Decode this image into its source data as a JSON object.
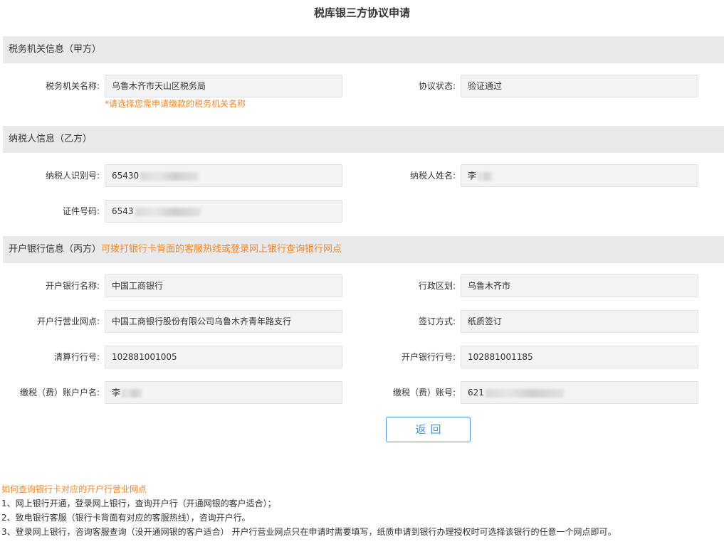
{
  "page": {
    "title": "税库银三方协议申请"
  },
  "section_a": {
    "header": "税务机关信息（甲方）",
    "tax_office_label": "税务机关名称:",
    "tax_office_value": "乌鲁木齐市天山区税务局",
    "tax_office_note": "*请选择您需申请缴款的税务机关名称",
    "status_label": "协议状态:",
    "status_value": "验证通过"
  },
  "section_b": {
    "header": "纳税人信息（乙方）",
    "taxpayer_id_label": "纳税人识别号:",
    "taxpayer_id_value": "65430",
    "taxpayer_name_label": "纳税人姓名:",
    "taxpayer_name_value": "李",
    "cert_no_label": "证件号码:",
    "cert_no_value": "6543"
  },
  "section_c": {
    "header": "开户银行信息（丙方）",
    "header_hint": "可拨打银行卡背面的客服热线或登录网上银行查询银行网点",
    "bank_name_label": "开户银行名称:",
    "bank_name_value": "中国工商银行",
    "region_label": "行政区划:",
    "region_value": "乌鲁木齐市",
    "branch_label": "开户行营业网点:",
    "branch_value": "中国工商银行股份有限公司乌鲁木齐青年路支行",
    "sign_method_label": "签订方式:",
    "sign_method_value": "纸质签订",
    "clearing_no_label": "清算行行号:",
    "clearing_no_value": "102881001005",
    "bank_no_label": "开户银行行号:",
    "bank_no_value": "102881001185",
    "account_name_label": "缴税（费）账户户名:",
    "account_name_value": "李",
    "account_no_label": "缴税（费）账号:",
    "account_no_value": "621"
  },
  "actions": {
    "back_label": "返回"
  },
  "help": {
    "title": "如何查询银行卡对应的开户行营业网点",
    "items": [
      "1、网上银行开通，登录网上银行，查询开户行（开通网银的客户适合）；",
      "2、致电银行客服（银行卡背面有对应的客服热线），咨询开户行。",
      "3、登录网上银行，咨询客服查询（没开通网银的客户适合） 开户行营业网点只在申请时需要填写，纸质申请到银行办理授权时可选择该银行的任意一个网点即可。"
    ]
  },
  "colors": {
    "accent_orange": "#f0882b",
    "button_blue": "#4a90d9",
    "section_bg": "#e8e9ea",
    "field_bg": "#f2f3f4"
  }
}
